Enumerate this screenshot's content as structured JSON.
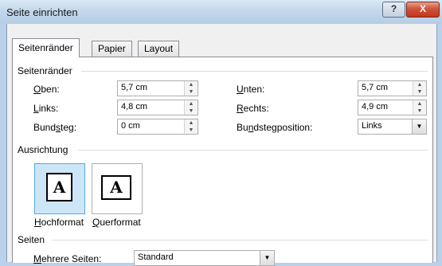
{
  "window": {
    "title": "Seite einrichten",
    "help_label": "?",
    "close_label": "X"
  },
  "tabs": [
    {
      "label": "Seitenränder"
    },
    {
      "label": "Papier"
    },
    {
      "label": "Layout"
    }
  ],
  "margins": {
    "section_title": "Seitenränder",
    "oben": {
      "label_u": "O",
      "label_rest": "ben:",
      "value": "5,7 cm"
    },
    "links": {
      "label_u": "L",
      "label_rest": "inks:",
      "value": "4,8 cm"
    },
    "bundsteg": {
      "label_pre": "Bund",
      "label_u": "s",
      "label_rest": "teg:",
      "value": "0 cm"
    },
    "unten": {
      "label_u": "U",
      "label_rest": "nten:",
      "value": "5,7 cm"
    },
    "rechts": {
      "label_u": "R",
      "label_rest": "echts:",
      "value": "4,9 cm"
    },
    "bundstegposition": {
      "label_pre": "Bu",
      "label_u": "n",
      "label_rest": "dstegposition:",
      "value": "Links"
    }
  },
  "orientation": {
    "section_title": "Ausrichtung",
    "portrait": {
      "glyph": "A",
      "label_u": "H",
      "label_rest": "ochformat"
    },
    "landscape": {
      "glyph": "A",
      "label_u": "Q",
      "label_rest": "uerformat"
    }
  },
  "pages": {
    "section_title": "Seiten",
    "multiple": {
      "label_u": "M",
      "label_rest": "ehrere Seiten:",
      "value": "Standard"
    }
  }
}
